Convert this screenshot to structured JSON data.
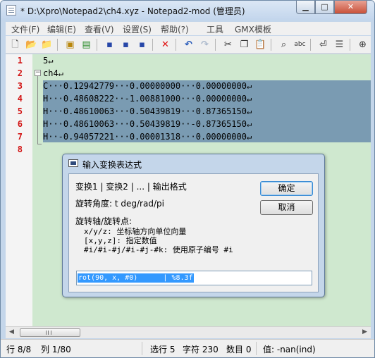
{
  "window": {
    "title": "* D:\\Xpro\\Notepad2\\ch4.xyz - Notepad2-mod (管理员)",
    "controls": {
      "minimize": "▁",
      "maximize": "□",
      "close": "✕"
    }
  },
  "menu": {
    "items": [
      "文件(F)",
      "编辑(E)",
      "查看(V)",
      "设置(S)",
      "帮助(?)",
      "工具",
      "GMX模板"
    ]
  },
  "toolbar": {
    "icons": [
      "new-icon",
      "open-icon",
      "browse-icon",
      "save-icon",
      "save-as-icon",
      "save-copy-icon",
      "close-doc-icon",
      "undo-icon",
      "redo-icon",
      "cut-icon",
      "copy-icon",
      "paste-icon",
      "find-icon",
      "replace-icon",
      "word-wrap-icon",
      "outline-icon",
      "zoom-icon"
    ]
  },
  "editor": {
    "colors": {
      "line_number": "#d21414",
      "background": "#cfe8cf",
      "selection": "#7a9bb2"
    },
    "lines": [
      {
        "number": "1",
        "text": "5↵"
      },
      {
        "number": "2",
        "text": "ch4↵"
      },
      {
        "number": "3",
        "text": "C···0.12942779···0.00000000···0.00000000↵"
      },
      {
        "number": "4",
        "text": "H···0.48608222··-1.00881000···0.00000000↵"
      },
      {
        "number": "5",
        "text": "H···0.48610063···0.50439819···0.87365150↵"
      },
      {
        "number": "6",
        "text": "H···0.48610063···0.50439819··-0.87365150↵"
      },
      {
        "number": "7",
        "text": "H··-0.94057221···0.00001318···0.00000000↵"
      },
      {
        "number": "8",
        "text": ""
      }
    ]
  },
  "statusbar": {
    "position": "行 8/8",
    "column": "列 1/80",
    "selection": "选行 5",
    "chars": "字符 230",
    "count": "数目 0",
    "value": "值: -nan(ind)"
  },
  "dialog": {
    "title": "输入变换表达式",
    "tabs_line": "变换1 | 变换2 | ... | 输出格式",
    "angle_line": "旋转角度: t deg/rad/pi",
    "axis_heading": "旋转轴/旋转点:",
    "axis_option_1": "x/y/z: 坐标轴方向单位向量",
    "axis_option_2": "[x,y,z]: 指定数值",
    "axis_option_3": "#i/#i-#j/#i-#j-#k: 使用原子编号 #i",
    "expression_value": "rot(90, x, #0)      | %8.3f",
    "ok_label": "确定",
    "cancel_label": "取消"
  }
}
